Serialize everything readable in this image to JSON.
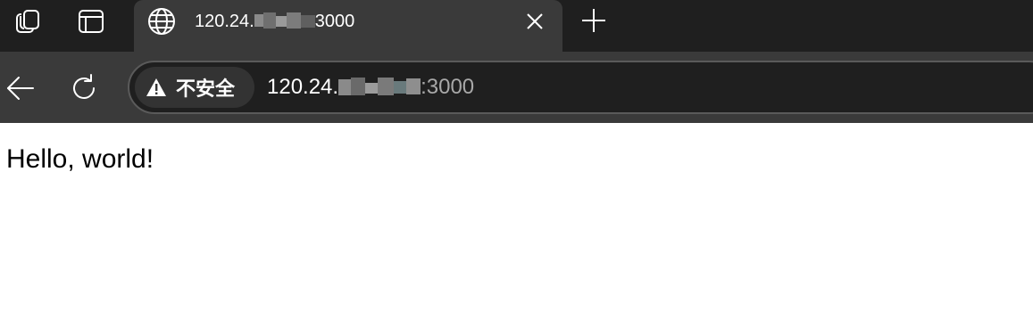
{
  "tab_strip": {
    "workspaces_icon": "workspaces-icon",
    "tab_actions_icon": "tab-actions-icon",
    "active_tab": {
      "favicon": "globe-icon",
      "title": "120.24.",
      "title_suffix": "3000",
      "close_icon": "close-icon"
    },
    "new_tab_icon": "plus-icon"
  },
  "toolbar": {
    "back_icon": "arrow-left-icon",
    "reload_icon": "refresh-icon",
    "address_bar": {
      "security_icon": "warning-icon",
      "security_label": "不安全",
      "url_host": "120.24.",
      "url_port": ":3000"
    }
  },
  "page": {
    "body_text": "Hello, world!"
  },
  "colors": {
    "tab_strip_bg": "#1f1f1f",
    "toolbar_bg": "#3a3a3a",
    "address_bg": "#1f1f1f",
    "page_bg": "#ffffff"
  }
}
